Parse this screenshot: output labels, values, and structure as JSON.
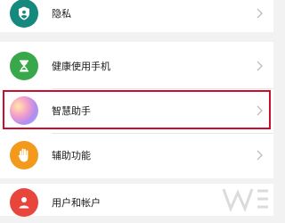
{
  "settings": {
    "items": [
      {
        "label": "隐私",
        "icon": "shield-user-icon",
        "color": "#15897e"
      },
      {
        "label": "健康使用手机",
        "icon": "hourglass-icon",
        "color": "#39a84a"
      },
      {
        "label": "智慧助手",
        "icon": "gradient-orb-icon",
        "color": "#c78be6"
      },
      {
        "label": "辅助功能",
        "icon": "hand-icon",
        "color": "#f39a1c"
      },
      {
        "label": "用户和帐户",
        "icon": "user-icon",
        "color": "#e8453c"
      }
    ]
  },
  "highlight_color": "#c8102e"
}
